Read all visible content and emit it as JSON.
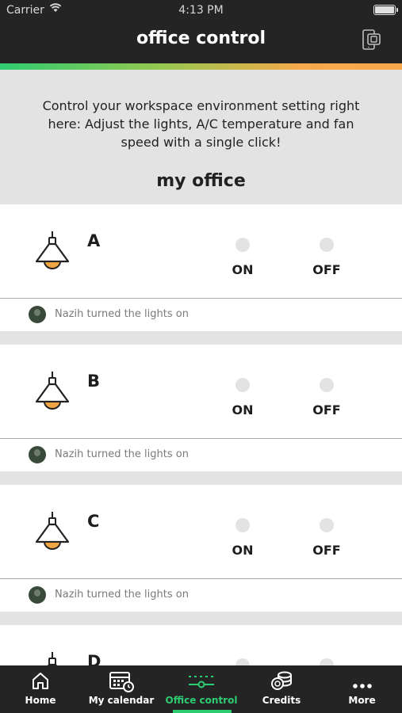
{
  "status_bar": {
    "carrier": "Carrier",
    "time": "4:13 PM"
  },
  "header": {
    "title": "office control",
    "action_icon": "phone-card-icon"
  },
  "colors": {
    "accent_green": "#2ecc71",
    "accent_orange": "#f7a64a",
    "header_bg": "#242424",
    "lamp_bulb": "#f0a545"
  },
  "intro": {
    "text": "Control your workspace environment setting right here: Adjust the lights, A/C temperature and fan speed with a single click!",
    "heading": "my office"
  },
  "rooms": [
    {
      "name": "A",
      "on_label": "ON",
      "off_label": "OFF",
      "activity": "Nazih turned the lights on"
    },
    {
      "name": "B",
      "on_label": "ON",
      "off_label": "OFF",
      "activity": "Nazih turned the lights on"
    },
    {
      "name": "C",
      "on_label": "ON",
      "off_label": "OFF",
      "activity": "Nazih turned the lights on"
    },
    {
      "name": "D",
      "on_label": "",
      "off_label": "",
      "activity": ""
    }
  ],
  "tabs": [
    {
      "label": "Home",
      "icon": "home-icon",
      "active": false
    },
    {
      "label": "My calendar",
      "icon": "calendar-icon",
      "active": false
    },
    {
      "label": "Office control",
      "icon": "sliders-icon",
      "active": true
    },
    {
      "label": "Credits",
      "icon": "coins-icon",
      "active": false
    },
    {
      "label": "More",
      "icon": "more-dots-icon",
      "active": false
    }
  ]
}
